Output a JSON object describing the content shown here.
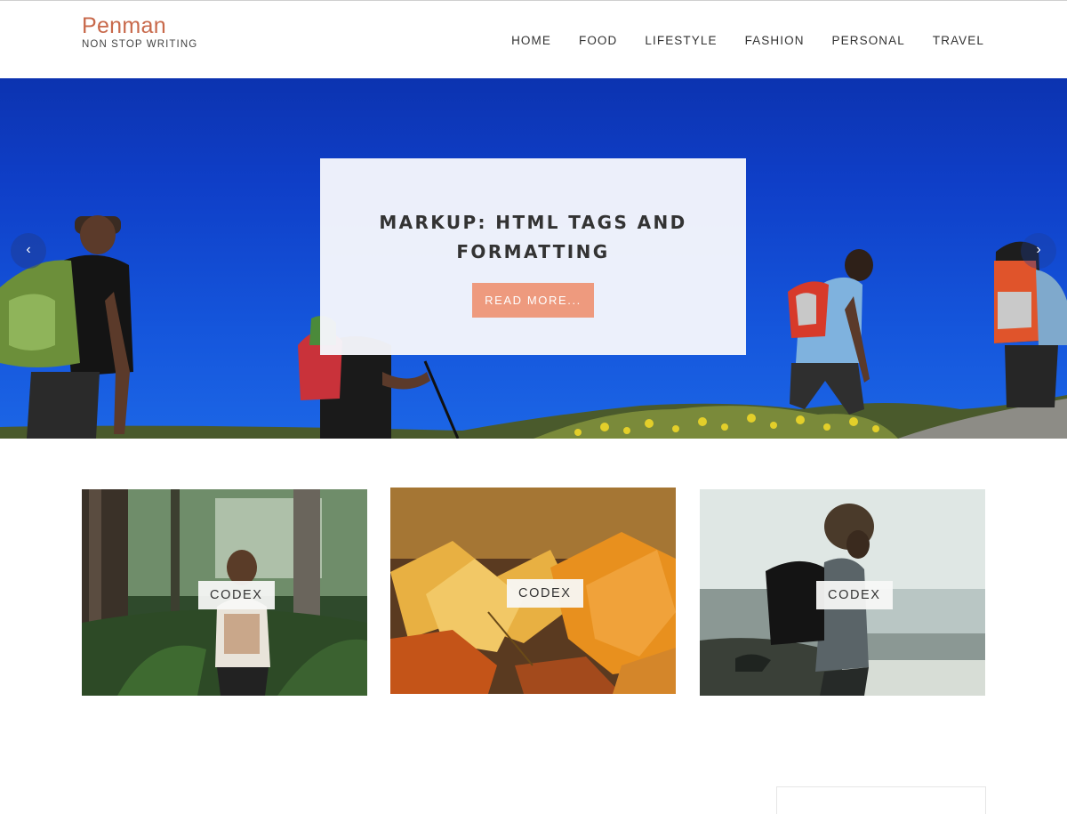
{
  "header": {
    "site_title": "Penman",
    "tagline": "NON STOP WRITING",
    "nav": [
      "HOME",
      "FOOD",
      "LIFESTYLE",
      "FASHION",
      "PERSONAL",
      "TRAVEL"
    ]
  },
  "hero": {
    "title_line1": "MARKUP: HTML TAGS AND",
    "title_line2": "FORMATTING",
    "read_more": "READ MORE...",
    "prev_arrow": "‹",
    "next_arrow": "›"
  },
  "cards": [
    {
      "label": "CODEX",
      "image": "forest-hiker-photo"
    },
    {
      "label": "CODEX",
      "image": "autumn-leaves-photo"
    },
    {
      "label": "CODEX",
      "image": "coast-backpacker-photo"
    }
  ],
  "colors": {
    "brand": "#c8694b",
    "button": "#ee9a7e",
    "sky": "#0f3fc8"
  }
}
